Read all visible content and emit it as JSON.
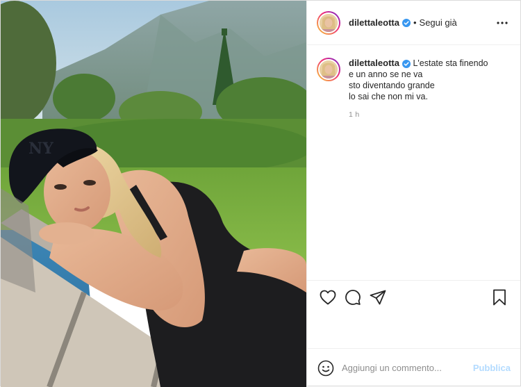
{
  "post": {
    "username": "dilettaleotta",
    "follow_status": "Segui già",
    "separator": "•",
    "caption": {
      "line1": "L'estate sta finendo",
      "line2": "e un anno se ne va",
      "line3": "sto diventando grande",
      "line4": "lo sai che non mi va."
    },
    "time": "1 h"
  },
  "comment_box": {
    "placeholder": "Aggiungi un commento...",
    "publish_label": "Pubblica"
  },
  "icons": {
    "verified": "verified-badge-icon",
    "more": "more-options-icon",
    "like": "heart-icon",
    "comment": "comment-bubble-icon",
    "share": "paper-plane-icon",
    "save": "bookmark-icon",
    "emoji": "emoji-smiley-icon"
  },
  "colors": {
    "verified_blue": "#3897f0",
    "publish_disabled": "#b3dbff",
    "secondary_text": "#8e8e8e"
  }
}
